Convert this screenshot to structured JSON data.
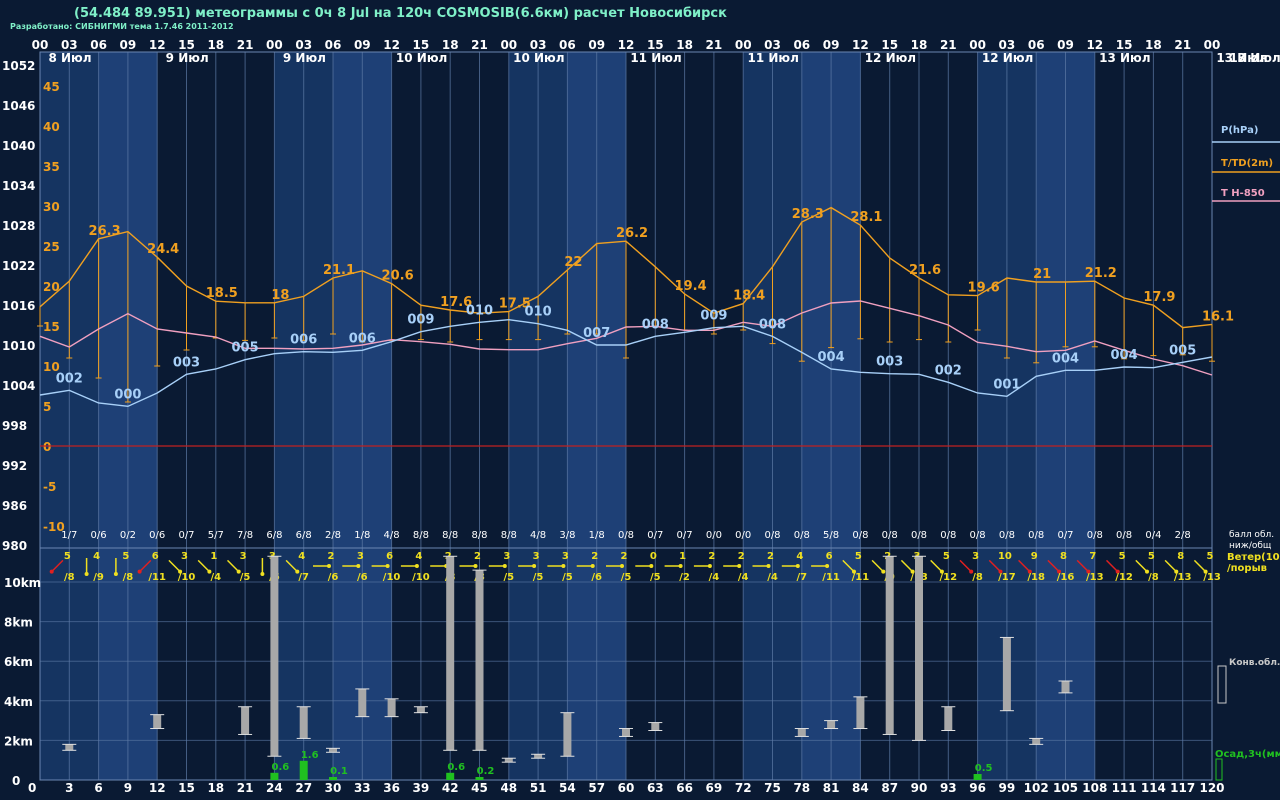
{
  "header": {
    "title": "(54.484 89.951) метеограммы с  0ч 8 Jul на 120ч COSMOSIB(6.6км) расчет Новосибирск",
    "credit": "Разработано: СИБНИГМИ тема 1.7.46 2011-2012"
  },
  "colors": {
    "background": "#0a1a33",
    "band_light": "#1a3d72",
    "pressure": "#a8d0f8",
    "temperature": "#f0a020",
    "t850": "#f0a0c0",
    "zero_line": "#c02020",
    "cloud_bar": "#a8a8a8",
    "precip_bar": "#20c020",
    "text_cyan": "#7ff0c8",
    "wind_yellow": "#f0e020",
    "wind_red": "#e02020"
  },
  "chart_data": [
    {
      "type": "line",
      "title": "",
      "x": [
        0,
        3,
        6,
        9,
        12,
        15,
        18,
        21,
        24,
        27,
        30,
        33,
        36,
        39,
        42,
        45,
        48,
        51,
        54,
        57,
        60,
        63,
        66,
        69,
        72,
        75,
        78,
        81,
        84,
        87,
        90,
        93,
        96,
        99,
        102,
        105,
        108,
        111,
        114,
        117,
        120
      ],
      "hour_ticks": [
        "00",
        "03",
        "06",
        "09",
        "12",
        "15",
        "18",
        "21",
        "00",
        "03",
        "06",
        "09",
        "12",
        "15",
        "18",
        "21",
        "00",
        "03",
        "06",
        "09",
        "12",
        "15",
        "18",
        "21",
        "00",
        "03",
        "06",
        "09",
        "12",
        "15",
        "18",
        "21",
        "00",
        "03",
        "06",
        "09",
        "12",
        "15",
        "18",
        "21",
        "00"
      ],
      "day_labels": [
        "8 Июл",
        "9 Июл",
        "9 Июл",
        "10 Июл",
        "10 Июл",
        "11 Июл",
        "11 Июл",
        "12 Июл",
        "12 Июл",
        "13 Июл",
        "13 Июл"
      ],
      "legend": [
        "P(hPa)",
        "T/TD(2m)",
        "T H-850"
      ],
      "left_axis_pressure": [
        "1052",
        "1046",
        "1040",
        "1034",
        "1028",
        "1022",
        "1016",
        "1010",
        "1004",
        "998",
        "992",
        "986",
        "980"
      ],
      "inner_axis_temp": [
        "45",
        "40",
        "35",
        "30",
        "25",
        "20",
        "15",
        "10",
        "5",
        "0",
        "-5",
        "-10"
      ],
      "pressure_ylim": [
        980,
        1052
      ],
      "temp_ylim": [
        -10,
        45
      ],
      "series": [
        {
          "name": "P(hPa)",
          "values": [
            1002.5,
            1003.2,
            1001.3,
            1000.8,
            1002.8,
            1005.6,
            1006.4,
            1007.8,
            1008.7,
            1009.0,
            1008.9,
            1009.2,
            1010.5,
            1012.0,
            1012.8,
            1013.4,
            1013.8,
            1013.2,
            1012.2,
            1010.0,
            1010.0,
            1011.3,
            1011.9,
            1012.6,
            1012.8,
            1011.3,
            1008.9,
            1006.4,
            1005.9,
            1005.7,
            1005.6,
            1004.4,
            1002.8,
            1002.3,
            1005.3,
            1006.2,
            1006.2,
            1006.7,
            1006.6,
            1007.4,
            1008.2
          ]
        },
        {
          "name": "T/TD(2m)",
          "values": [
            17.4,
            20.6,
            25.9,
            26.8,
            23.6,
            20.0,
            18.1,
            17.9,
            17.9,
            18.7,
            21.0,
            21.9,
            20.3,
            17.6,
            17.0,
            16.6,
            16.8,
            18.7,
            22.0,
            25.3,
            25.6,
            22.4,
            19.0,
            16.6,
            17.8,
            22.4,
            28.0,
            29.8,
            27.6,
            23.5,
            21.0,
            18.9,
            18.8,
            21.0,
            20.5,
            20.5,
            20.6,
            18.5,
            17.6,
            14.8,
            15.2
          ],
          "labels": [
            null,
            null,
            "26.3",
            null,
            "24.4",
            null,
            "18.5",
            null,
            "18",
            null,
            "21.1",
            null,
            "20.6",
            null,
            "17.6",
            null,
            "17.5",
            null,
            "22",
            null,
            "26.2",
            null,
            "19.4",
            null,
            "18.4",
            null,
            "28.3",
            null,
            "28.1",
            null,
            "21.6",
            null,
            "19.6",
            null,
            "21",
            null,
            "21.2",
            null,
            "17.9",
            null,
            "16.1"
          ]
        },
        {
          "name": "TD(2m)",
          "values": [
            15.0,
            11.0,
            8.5,
            5.5,
            10.0,
            12.0,
            13.5,
            13.2,
            13.5,
            13.2,
            14.0,
            13.0,
            13.2,
            13.3,
            13.0,
            13.3,
            13.3,
            13.3,
            14.0,
            14.0,
            11.0,
            15.0,
            14.5,
            14.0,
            14.5,
            12.8,
            10.6,
            12.3,
            13.4,
            13.0,
            13.3,
            13.0,
            14.5,
            11.0,
            10.4,
            12.4,
            12.4,
            10.9,
            11.3,
            11.4,
            10.6
          ]
        },
        {
          "name": "T H-850",
          "values": [
            1011.3,
            1009.7,
            1012.4,
            1014.7,
            1012.4,
            1011.8,
            1011.2,
            1009.5,
            1009.5,
            1009.4,
            1009.5,
            1010.0,
            1010.8,
            1010.5,
            1010.1,
            1009.4,
            1009.3,
            1009.3,
            1010.2,
            1011.0,
            1012.7,
            1012.8,
            1012.2,
            1012.2,
            1013.4,
            1012.8,
            1014.8,
            1016.3,
            1016.6,
            1015.5,
            1014.4,
            1013.0,
            1010.4,
            1009.8,
            1009.0,
            1009.2,
            1010.6,
            1009.2,
            1007.9,
            1006.9,
            1005.5
          ]
        }
      ],
      "x_label_codes": [
        "002",
        "000",
        "003",
        "005",
        "006",
        "006",
        "009",
        "010",
        "010",
        "007",
        "008",
        "009",
        "008",
        "004",
        "003",
        "002",
        "001",
        "004",
        "004",
        "005"
      ],
      "cloud_fraction": [
        "1/7",
        "0/6",
        "0/2",
        "0/6",
        "0/7",
        "5/7",
        "7/8",
        "6/8",
        "6/8",
        "2/8",
        "1/8",
        "4/8",
        "8/8",
        "8/8",
        "8/8",
        "8/8",
        "4/8",
        "3/8",
        "1/8",
        "0/8",
        "0/7",
        "0/7",
        "0/0",
        "0/0",
        "0/8",
        "0/8",
        "5/8",
        "0/8",
        "0/8",
        "0/8",
        "0/8",
        "0/8",
        "0/8",
        "0/8",
        "0/7",
        "0/8",
        "0/8",
        "0/4",
        "2/8"
      ],
      "cloud_fraction_label": "балл обл.\nниж/общ"
    },
    {
      "type": "bar",
      "title": "",
      "wind_label": "Ветер(10м)\n/порыв",
      "wind": [
        {
          "speed": "5",
          "gust": "/8",
          "dir": "nw"
        },
        {
          "speed": "4",
          "gust": "/9",
          "dir": "n"
        },
        {
          "speed": "5",
          "gust": "/8",
          "dir": "n"
        },
        {
          "speed": "6",
          "gust": "/11",
          "dir": "nw"
        },
        {
          "speed": "3",
          "gust": "/10",
          "dir": "ne"
        },
        {
          "speed": "1",
          "gust": "/4",
          "dir": "ne"
        },
        {
          "speed": "3",
          "gust": "/5",
          "dir": "ne"
        },
        {
          "speed": "3",
          "gust": "/6",
          "dir": "n"
        },
        {
          "speed": "4",
          "gust": "/7",
          "dir": "ne"
        },
        {
          "speed": "2",
          "gust": "/6",
          "dir": "e"
        },
        {
          "speed": "3",
          "gust": "/6",
          "dir": "e"
        },
        {
          "speed": "6",
          "gust": "/10",
          "dir": "e"
        },
        {
          "speed": "4",
          "gust": "/10",
          "dir": "e"
        },
        {
          "speed": "2",
          "gust": "/8",
          "dir": "e"
        },
        {
          "speed": "2",
          "gust": "/8",
          "dir": "e"
        },
        {
          "speed": "3",
          "gust": "/5",
          "dir": "e"
        },
        {
          "speed": "3",
          "gust": "/5",
          "dir": "e"
        },
        {
          "speed": "3",
          "gust": "/5",
          "dir": "e"
        },
        {
          "speed": "2",
          "gust": "/6",
          "dir": "e"
        },
        {
          "speed": "2",
          "gust": "/5",
          "dir": "e"
        },
        {
          "speed": "0",
          "gust": "/5",
          "dir": "e"
        },
        {
          "speed": "1",
          "gust": "/2",
          "dir": "e"
        },
        {
          "speed": "2",
          "gust": "/4",
          "dir": "e"
        },
        {
          "speed": "2",
          "gust": "/4",
          "dir": "e"
        },
        {
          "speed": "2",
          "gust": "/4",
          "dir": "e"
        },
        {
          "speed": "4",
          "gust": "/7",
          "dir": "e"
        },
        {
          "speed": "6",
          "gust": "/11",
          "dir": "e"
        },
        {
          "speed": "5",
          "gust": "/11",
          "dir": "ne"
        },
        {
          "speed": "2",
          "gust": "/9",
          "dir": "ne"
        },
        {
          "speed": "3",
          "gust": "/13",
          "dir": "ne"
        },
        {
          "speed": "5",
          "gust": "/12",
          "dir": "ne"
        },
        {
          "speed": "3",
          "gust": "/8",
          "dir": "ne"
        },
        {
          "speed": "10",
          "gust": "/17",
          "dir": "ne"
        },
        {
          "speed": "9",
          "gust": "/18",
          "dir": "ne"
        },
        {
          "speed": "8",
          "gust": "/16",
          "dir": "ne"
        },
        {
          "speed": "7",
          "gust": "/13",
          "dir": "ne"
        },
        {
          "speed": "5",
          "gust": "/12",
          "dir": "ne"
        },
        {
          "speed": "5",
          "gust": "/8",
          "dir": "ne"
        },
        {
          "speed": "8",
          "gust": "/13",
          "dir": "ne"
        },
        {
          "speed": "5",
          "gust": "/13",
          "dir": "ne"
        }
      ],
      "km_axis": [
        "10km",
        "8km",
        "6km",
        "4km",
        "2km",
        "0"
      ],
      "bottom_hours": [
        "3",
        "6",
        "9",
        "12",
        "15",
        "18",
        "21",
        "24",
        "27",
        "30",
        "33",
        "36",
        "39",
        "42",
        "45",
        "48",
        "51",
        "54",
        "57",
        "60",
        "63",
        "66",
        "69",
        "72",
        "75",
        "78",
        "81",
        "84",
        "87",
        "90",
        "93",
        "96",
        "99",
        "102",
        "105",
        "108",
        "111",
        "114",
        "117",
        "120"
      ],
      "cloud_bars": [
        {
          "x": 3,
          "bottom": 1.5,
          "top": 1.8
        },
        {
          "x": 12,
          "bottom": 2.6,
          "top": 3.3
        },
        {
          "x": 21,
          "bottom": 2.3,
          "top": 3.7
        },
        {
          "x": 24,
          "bottom": 1.2,
          "top": 11.5
        },
        {
          "x": 27,
          "bottom": 2.1,
          "top": 3.7
        },
        {
          "x": 30,
          "bottom": 1.4,
          "top": 1.6
        },
        {
          "x": 33,
          "bottom": 3.2,
          "top": 4.6
        },
        {
          "x": 36,
          "bottom": 3.2,
          "top": 4.1
        },
        {
          "x": 39,
          "bottom": 3.4,
          "top": 3.7
        },
        {
          "x": 42,
          "bottom": 1.5,
          "top": 11.8
        },
        {
          "x": 45,
          "bottom": 1.5,
          "top": 10.6
        },
        {
          "x": 48,
          "bottom": 0.9,
          "top": 1.1
        },
        {
          "x": 51,
          "bottom": 1.1,
          "top": 1.3
        },
        {
          "x": 54,
          "bottom": 1.2,
          "top": 3.4
        },
        {
          "x": 60,
          "bottom": 2.2,
          "top": 2.6
        },
        {
          "x": 63,
          "bottom": 2.5,
          "top": 2.9
        },
        {
          "x": 78,
          "bottom": 2.2,
          "top": 2.6
        },
        {
          "x": 81,
          "bottom": 2.6,
          "top": 3.0
        },
        {
          "x": 84,
          "bottom": 2.6,
          "top": 4.2
        },
        {
          "x": 87,
          "bottom": 2.3,
          "top": 12.5
        },
        {
          "x": 90,
          "bottom": 2.0,
          "top": 12.5
        },
        {
          "x": 93,
          "bottom": 2.5,
          "top": 3.7
        },
        {
          "x": 99,
          "bottom": 3.5,
          "top": 7.2
        },
        {
          "x": 102,
          "bottom": 1.8,
          "top": 2.1
        },
        {
          "x": 105,
          "bottom": 4.4,
          "top": 5.0
        }
      ],
      "precip": [
        {
          "x": 24,
          "value": 0.6,
          "label": "0.6"
        },
        {
          "x": 27,
          "value": 1.6,
          "label": "1.6"
        },
        {
          "x": 30,
          "value": 0.1,
          "label": "0.1"
        },
        {
          "x": 42,
          "value": 0.6,
          "label": "0.6"
        },
        {
          "x": 45,
          "value": 0.2,
          "label": "0.2"
        },
        {
          "x": 96,
          "value": 0.5,
          "label": "0.5"
        }
      ],
      "legend": [
        "Конв.обл.",
        "Осад,3ч(мм)"
      ]
    }
  ]
}
